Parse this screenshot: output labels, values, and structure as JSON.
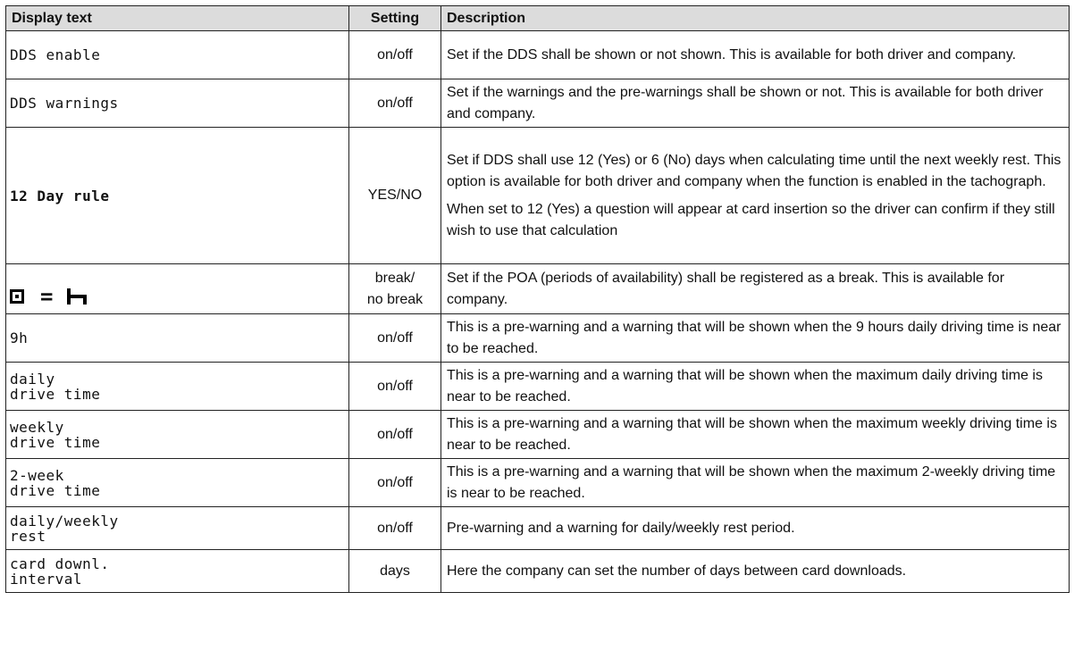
{
  "headers": {
    "display": "Display text",
    "setting": "Setting",
    "description": "Description"
  },
  "rows": [
    {
      "display": "DDS enable",
      "setting": "on/off",
      "description": [
        "Set if the DDS shall be shown or not shown. This is available for both driver and company."
      ]
    },
    {
      "display": "DDS warnings",
      "setting": "on/off",
      "description": [
        "Set if the warnings and the pre-warnings shall be shown or not. This is available for both driver and company."
      ]
    },
    {
      "display": "12 Day rule",
      "setting": "YES/NO",
      "description": [
        "Set if DDS shall use 12 (Yes) or 6 (No) days when calculating time until the next weekly rest. This option is available for both driver and company when the function is enabled in the tachograph.",
        "When set to 12 (Yes) a question will appear at card insertion so the driver can confirm if they still wish to use that calculation"
      ]
    },
    {
      "display_icon": "poa-equals-break-icon",
      "setting": "break/\nno break",
      "description": [
        "Set if the POA (periods of availability) shall be registered as a break. This is available for company."
      ]
    },
    {
      "display": "9h",
      "setting": "on/off",
      "description": [
        "This is a pre-warning and a warning that will be shown when the 9 hours daily driving time is near to be reached."
      ]
    },
    {
      "display": "daily\ndrive time",
      "setting": "on/off",
      "description": [
        "This is a pre-warning and a warning that will be shown when the maximum daily driving time is near to be reached."
      ]
    },
    {
      "display": "weekly\ndrive time",
      "setting": "on/off",
      "description": [
        "This is a pre-warning and a warning that will be shown when the maximum weekly driving time is near to be reached."
      ]
    },
    {
      "display": "2-week\ndrive time",
      "setting": "on/off",
      "description": [
        "This is a pre-warning and a warning that will be shown when the maximum 2-weekly driving time is near to be reached."
      ]
    },
    {
      "display": "daily/weekly\nrest",
      "setting": "on/off",
      "description": [
        "Pre-warning and a warning for daily/weekly rest period."
      ]
    },
    {
      "display": "card downl.\ninterval",
      "setting": "days",
      "description": [
        "Here the company can set the number of days between card downloads."
      ]
    }
  ]
}
